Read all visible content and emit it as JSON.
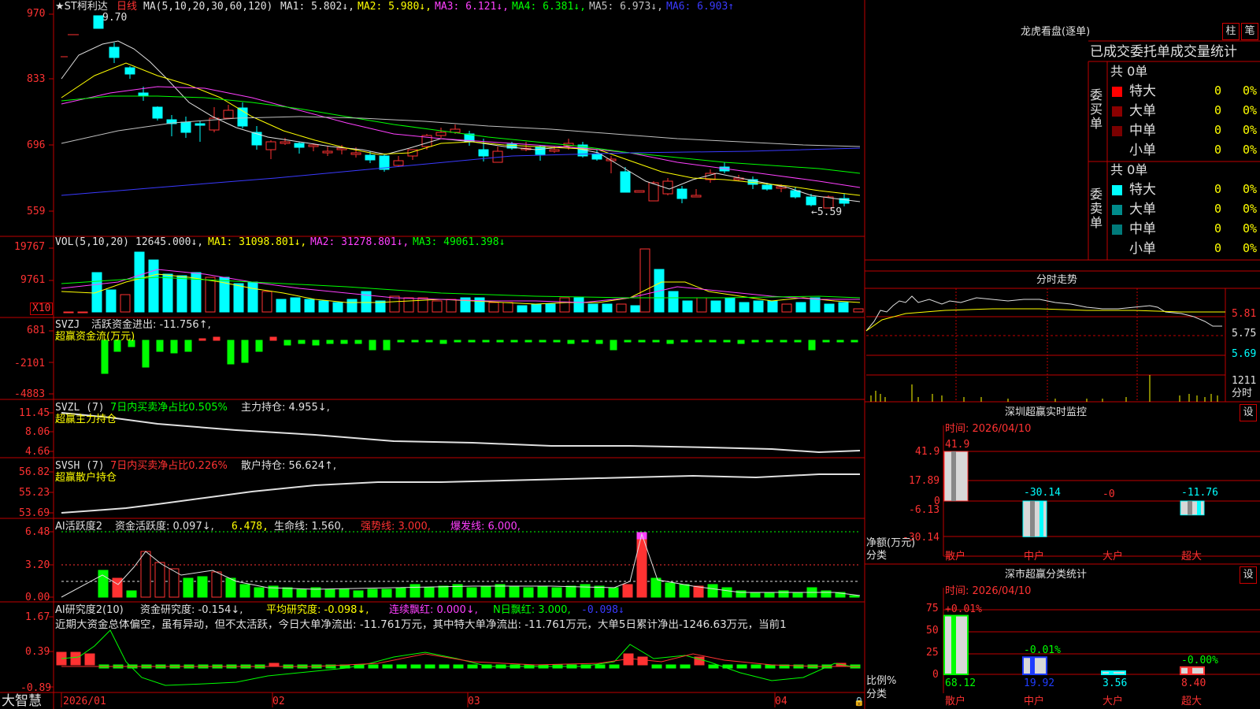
{
  "app": {
    "logo": "大智慧"
  },
  "colors": {
    "up": "#ff3232",
    "down": "#00ffff",
    "frame": "#c00000",
    "bg": "#000000",
    "ma1": "#e0e0e0",
    "ma2": "#ffff00",
    "ma3": "#ff40ff",
    "ma4": "#00ff00",
    "ma5": "#c0c0c0",
    "ma6": "#3a3aff"
  },
  "main_chart": {
    "y_ticks": [
      "970",
      "833",
      "696",
      "559"
    ],
    "stock_name": "★ST柯利达",
    "period": "日线",
    "ma_params": "MA(5,10,20,30,60,120)",
    "ma1": "MA1: 5.802↓,",
    "ma2": "MA2: 5.980↓,",
    "ma3": "MA3: 6.121↓,",
    "ma4": "MA4: 6.381↓,",
    "ma5": "MA5: 6.973↓,",
    "ma6": "MA6: 6.903↑",
    "high_label": "9.70",
    "low_label": "←5.59"
  },
  "vol_panel": {
    "y_ticks": [
      "19767",
      "9761"
    ],
    "unit": "X10",
    "label": "VOL(5,10,20)",
    "value": "12645.000↓,",
    "ma1": "MA1: 31098.801↓,",
    "ma2": "MA2: 31278.801↓,",
    "ma3": "MA3: 49061.398↓"
  },
  "svzj_panel": {
    "y_ticks": [
      "681",
      "-2101",
      "-4883"
    ],
    "label": "SVZJ",
    "value": "活跃资金进出: -11.756↑,",
    "title": "超赢资金流(万元)"
  },
  "svzl_panel": {
    "y_ticks": [
      "11.45",
      "8.06",
      "4.66"
    ],
    "label": "SVZL (7)",
    "ratio": "7日内买卖净占比0.505%",
    "value": "主力持仓: 4.955↓,",
    "title": "超赢主力持仓"
  },
  "svsh_panel": {
    "y_ticks": [
      "56.82",
      "55.23",
      "53.69"
    ],
    "label": "SVSH (7)",
    "ratio": "7日内买卖净占比0.226%",
    "value": "散户持仓: 56.624↑,",
    "title": "超赢散户持仓"
  },
  "ai_active_panel": {
    "y_ticks": [
      "6.48",
      "3.20",
      "0.00"
    ],
    "label": "AI活跃度2",
    "value1": "资金活跃度: 0.097↓,",
    "value2": "6.478,",
    "value3": "生命线: 1.560,",
    "value4": "强势线: 3.000,",
    "value5": "爆发线: 6.000,"
  },
  "ai_research_panel": {
    "y_ticks": [
      "1.67",
      "0.39",
      "-0.89"
    ],
    "label": "AI研究度2(10)",
    "value1": "资金研究度: -0.154↓,",
    "value2": "平均研究度: -0.098↓,",
    "value3": "连续飘红: 0.000↓,",
    "value4": "N日飘红: 3.000,",
    "value5": "-0.098↓",
    "comment": "近期大资金总体偏空，虽有异动，但不太活跃，今日大单净流出: -11.761万元，其中特大单净流出: -11.761万元，大单5日累计净出-1246.63万元，当前1"
  },
  "x_axis": {
    "labels": [
      "2026/01",
      "02",
      "03",
      "04"
    ]
  },
  "dragon_tiger": {
    "title": "龙虎看盘(逐单)",
    "btn_column": "柱",
    "btn_pen": "笔",
    "header": "已成交委托单成交量统计",
    "buy_side_label": "委买单",
    "sell_side_label": "委卖单",
    "buy_total": "共 0单",
    "sell_total": "共 0单",
    "buy_rows": [
      {
        "name": "特大",
        "count": "0",
        "pct": "0%",
        "color": "#ff0000"
      },
      {
        "name": "大单",
        "count": "0",
        "pct": "0%",
        "color": "#8b0000"
      },
      {
        "name": "中单",
        "count": "0",
        "pct": "0%",
        "color": "#7a0000"
      },
      {
        "name": "小单",
        "count": "0",
        "pct": "0%",
        "color": "#000000"
      }
    ],
    "sell_rows": [
      {
        "name": "特大",
        "count": "0",
        "pct": "0%",
        "color": "#00ffff"
      },
      {
        "name": "大单",
        "count": "0",
        "pct": "0%",
        "color": "#008b8b"
      },
      {
        "name": "中单",
        "count": "0",
        "pct": "0%",
        "color": "#007a7a"
      },
      {
        "name": "小单",
        "count": "0",
        "pct": "0%",
        "color": "#000000"
      }
    ]
  },
  "intraday": {
    "title": "分时走势",
    "y_ticks": [
      "5.81",
      "5.75",
      "5.69"
    ],
    "vol_tick": "1211",
    "vol_label": "分时"
  },
  "sz_monitor": {
    "title": "深圳超赢实时监控",
    "btn": "设",
    "time_label": "时间: 2026/04/10",
    "y_ticks": [
      "41.9",
      "17.89",
      "0",
      "-6.13",
      "-30.14"
    ],
    "y_label1": "净额(万元)",
    "y_label2": "分类",
    "categories": [
      "散户",
      "中户",
      "大户",
      "超大"
    ],
    "values": [
      41.9,
      -30.14,
      0,
      -11.76
    ],
    "value_labels": [
      "41.9",
      "-30.14",
      "-0",
      "-11.76"
    ]
  },
  "sz_classify": {
    "title": "深市超赢分类统计",
    "btn": "设",
    "time_label": "时间: 2026/04/10",
    "y_ticks": [
      "75",
      "50",
      "25",
      "0"
    ],
    "y_label1": "比例%",
    "y_label2": "分类",
    "categories": [
      "散户",
      "中户",
      "大户",
      "超大"
    ],
    "values": [
      68.12,
      19.92,
      3.56,
      8.4
    ],
    "value_labels": [
      "68.12",
      "19.92",
      "3.56",
      "8.40"
    ],
    "change_labels": [
      "+0.01%",
      "-0.01%",
      "",
      "-0.00%"
    ]
  }
}
